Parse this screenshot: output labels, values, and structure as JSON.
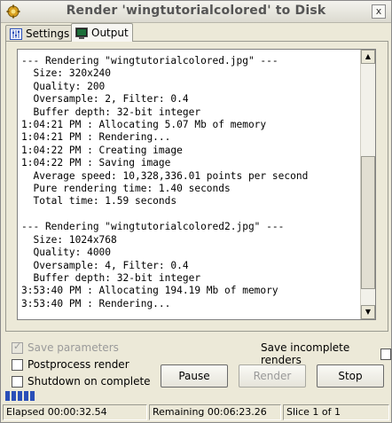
{
  "window": {
    "title": "Render 'wingtutorialcolored' to Disk",
    "close_glyph": "x"
  },
  "tabs": [
    {
      "label": "Settings",
      "icon": "sliders-icon",
      "active": false
    },
    {
      "label": "Output",
      "icon": "monitor-icon",
      "active": true
    }
  ],
  "log_lines": [
    "--- Rendering \"wingtutorialcolored.jpg\" ---",
    "  Size: 320x240",
    "  Quality: 200",
    "  Oversample: 2, Filter: 0.4",
    "  Buffer depth: 32-bit integer",
    "1:04:21 PM : Allocating 5.07 Mb of memory",
    "1:04:21 PM : Rendering...",
    "1:04:22 PM : Creating image",
    "1:04:22 PM : Saving image",
    "  Average speed: 10,328,336.01 points per second",
    "  Pure rendering time: 1.40 seconds",
    "  Total time: 1.59 seconds",
    "",
    "--- Rendering \"wingtutorialcolored2.jpg\" ---",
    "  Size: 1024x768",
    "  Quality: 4000",
    "  Oversample: 4, Filter: 0.4",
    "  Buffer depth: 32-bit integer",
    "3:53:40 PM : Allocating 194.19 Mb of memory",
    "3:53:40 PM : Rendering..."
  ],
  "options": {
    "save_parameters": {
      "label": "Save parameters",
      "checked": true,
      "enabled": false
    },
    "postprocess_render": {
      "label": "Postprocess render",
      "checked": false
    },
    "shutdown_on_complete": {
      "label": "Shutdown on complete",
      "checked": false
    },
    "save_incomplete_renders": {
      "label": "Save incomplete renders",
      "checked": false
    }
  },
  "buttons": {
    "pause": "Pause",
    "render": "Render",
    "stop": "Stop"
  },
  "progress": {
    "fraction": 0.085,
    "color": "#2a4fb8"
  },
  "status": {
    "elapsed": "Elapsed 00:00:32.54",
    "remaining": "Remaining 00:06:23.26",
    "slice": "Slice 1 of 1"
  }
}
